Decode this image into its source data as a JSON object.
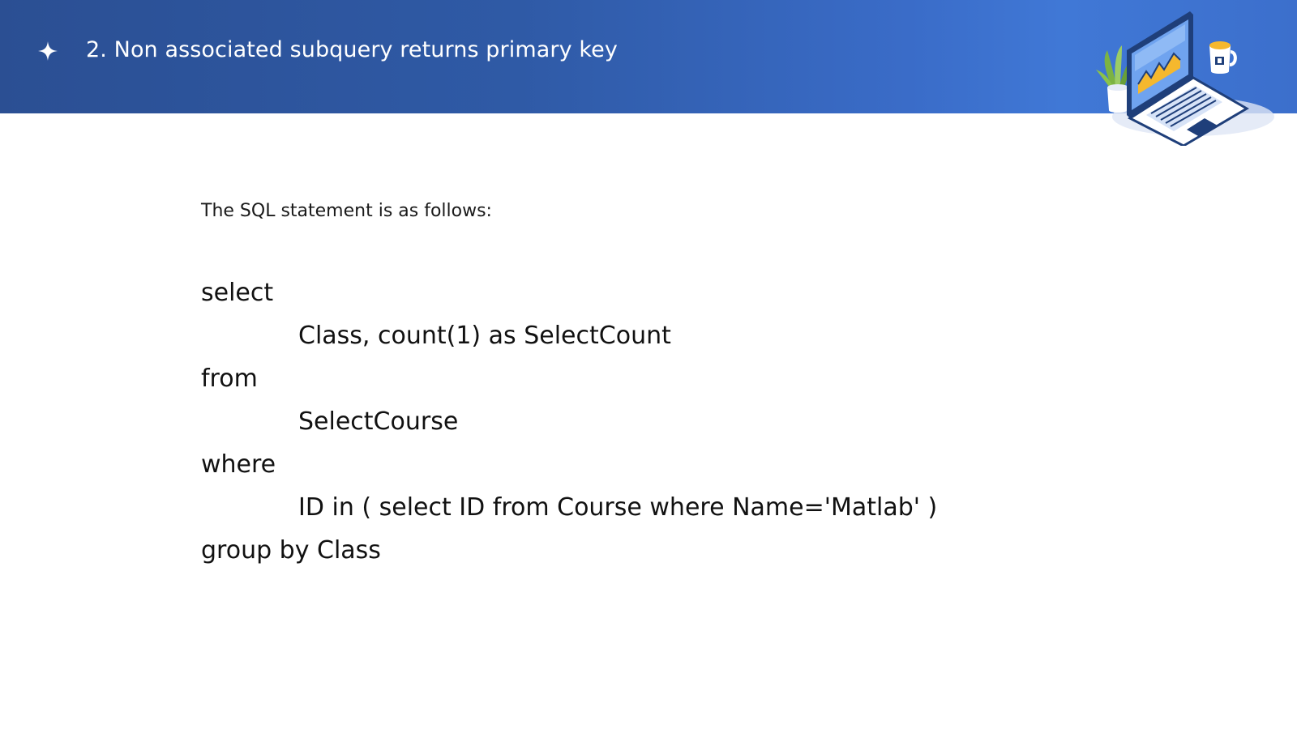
{
  "header": {
    "star_icon": "four-point-star-icon",
    "title": "2. Non associated subquery returns primary key",
    "illustration": "laptop-workspace-illustration",
    "colors": {
      "gradient_start": "#2b4f93",
      "gradient_end": "#4078d6",
      "title": "#ffffff"
    }
  },
  "content": {
    "intro": "The SQL statement is as follows:",
    "sql_lines": [
      "select",
      "Class, count(1) as SelectCount",
      "from",
      "SelectCourse",
      "where",
      "ID in ( select ID from Course where Name='Matlab' )",
      "group by Class"
    ]
  }
}
